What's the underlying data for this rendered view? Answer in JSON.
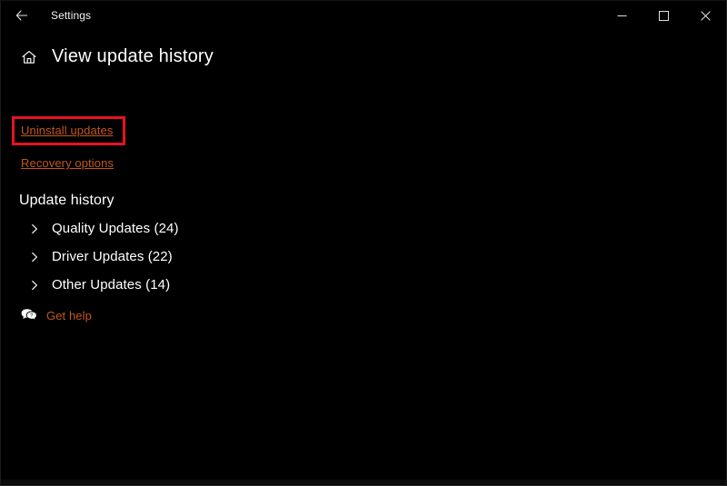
{
  "window": {
    "app_title": "Settings",
    "back_icon": "back-arrow-icon",
    "minimize_label": "─",
    "maximize_label": "□",
    "close_label": "✕"
  },
  "page": {
    "home_icon": "home-icon",
    "title": "View update history"
  },
  "links": {
    "uninstall_updates": "Uninstall updates",
    "recovery_options": "Recovery options"
  },
  "annotation": {
    "target": "Uninstall updates",
    "color": "#e81123"
  },
  "update_history": {
    "heading": "Update history",
    "groups": [
      {
        "label": "Quality Updates (24)",
        "icon": "chevron-right-icon",
        "expanded": false
      },
      {
        "label": "Driver Updates (22)",
        "icon": "chevron-right-icon",
        "expanded": false
      },
      {
        "label": "Other Updates (14)",
        "icon": "chevron-right-icon",
        "expanded": false
      }
    ]
  },
  "help": {
    "icon": "chat-help-icon",
    "label": "Get help"
  },
  "colors": {
    "background": "#000000",
    "text": "#ffffff",
    "link": "#c2571c",
    "annotation": "#e81123"
  }
}
